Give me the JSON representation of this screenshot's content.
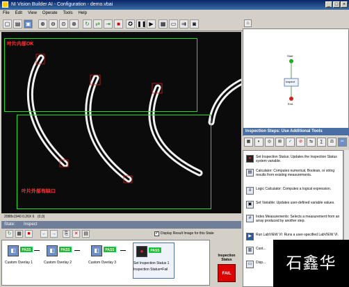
{
  "window": {
    "title": "NI Vision Builder AI - Configuration - demo.vbai"
  },
  "menu": {
    "items": [
      "File",
      "Edit",
      "View",
      "Operate",
      "Tools",
      "Help"
    ]
  },
  "image_overlays": {
    "inner_label": "叶片内部OK",
    "outer_label": "叶片外部有缺口"
  },
  "image_info": {
    "left": "2088x1940  0.26X 6",
    "right": "(0,0)"
  },
  "state_bar": {
    "label": "State:",
    "value": "Inspect"
  },
  "display_checkbox": {
    "label": "Display Result Image for this State",
    "checked": true
  },
  "steps": [
    {
      "label": "Custom Overlay 1",
      "badge": "PASS"
    },
    {
      "label": "Custom Overlay 2",
      "badge": "PASS"
    },
    {
      "label": "Custom Overlay 3",
      "badge": "PASS"
    },
    {
      "label": "Set Inspection Status 1",
      "badge": "PASS",
      "sub": "Inspection Status=Fail"
    }
  ],
  "inspection_status": {
    "title": "Inspection Status",
    "value": "FAIL"
  },
  "flow": {
    "start": "Start",
    "inspect": "Inspect",
    "end": "End"
  },
  "panel_header": "Inspection Steps: Use Additional Tools",
  "tools": [
    {
      "icon": "status-icon",
      "text": "Set Inspection Status: Updates the Inspection Status system variable."
    },
    {
      "icon": "calculator-icon",
      "text": "Calculator: Computes numerical, Boolean, or string results from existing measurements."
    },
    {
      "icon": "logic-icon",
      "text": "Logic Calculator: Computes a logical expression."
    },
    {
      "icon": "variable-icon",
      "text": "Set Variable: Updates user-defined variable values."
    },
    {
      "icon": "index-icon",
      "text": "Index Measurements: Selects a measurement from an array produced by another step."
    },
    {
      "icon": "labview-icon",
      "text": "Run LabVIEW VI: Runs a user-specified LabVIEW VI."
    },
    {
      "icon": "custom-icon",
      "text": "Cust..."
    },
    {
      "icon": "display-icon",
      "text": "Disp..."
    }
  ],
  "watermark": "石鑫华",
  "colors": {
    "roi": "#22dd22",
    "label": "#ff3333",
    "pass": "#22aa22",
    "fail": "#dd0000",
    "accent": "#4a6fa5"
  }
}
